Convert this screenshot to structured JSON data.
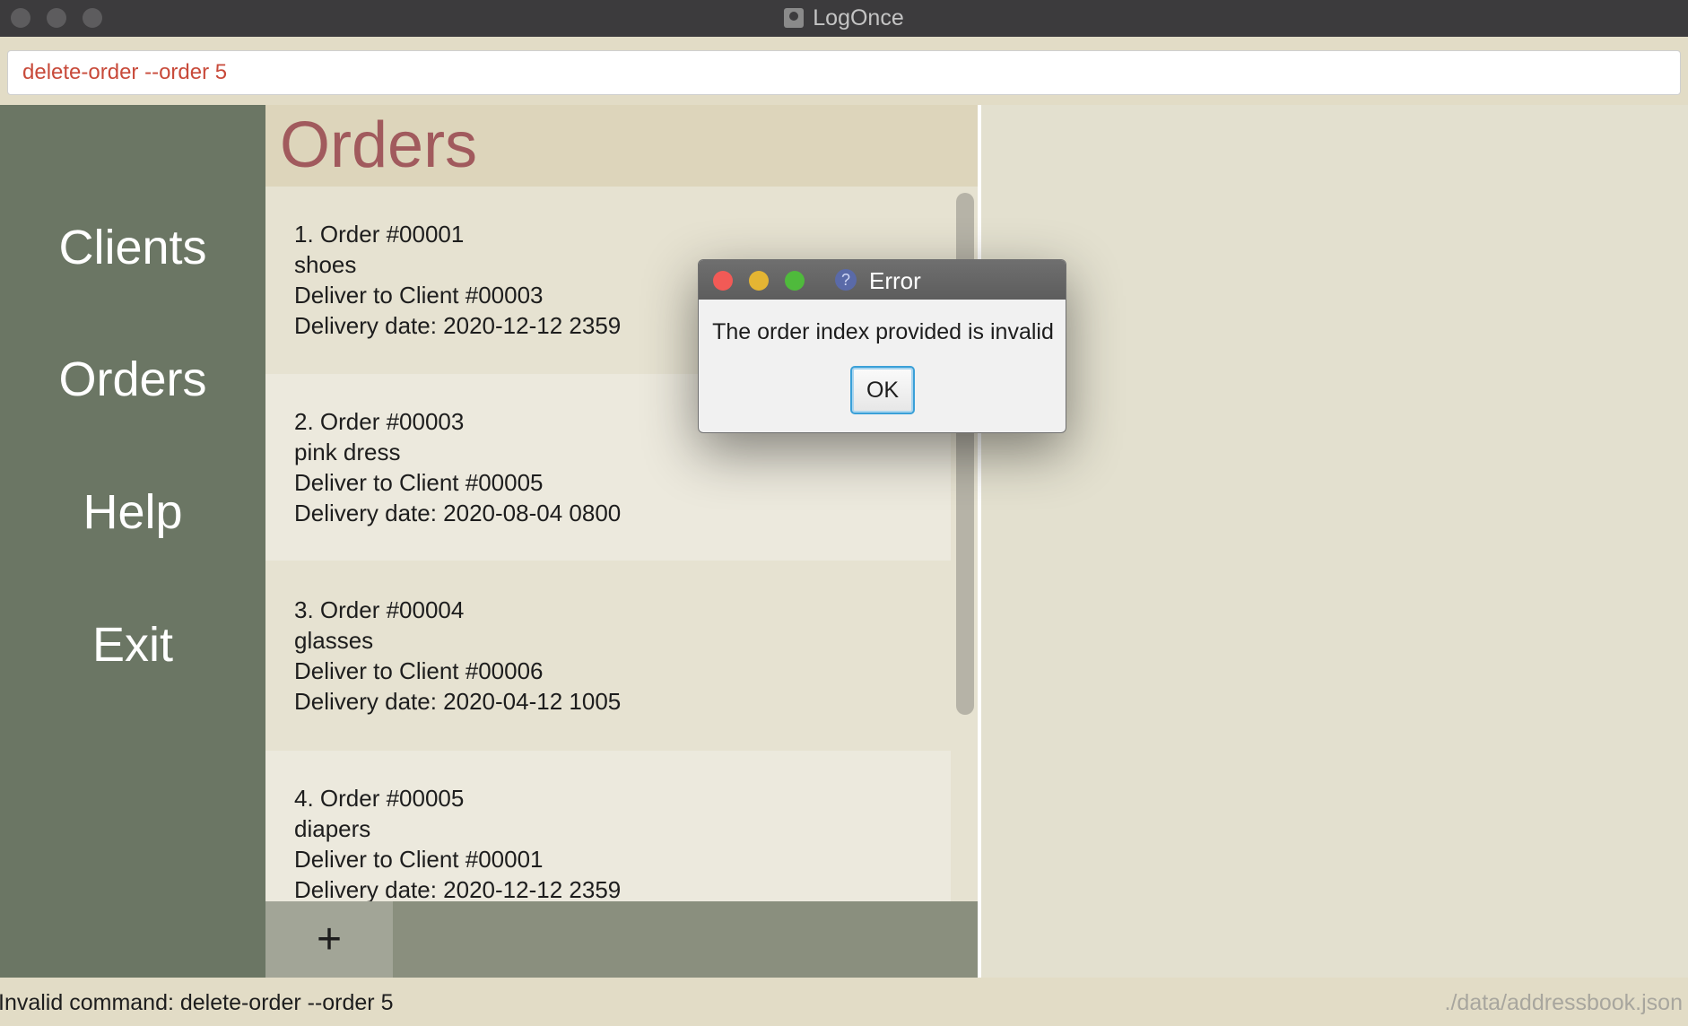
{
  "window": {
    "title": "LogOnce"
  },
  "command": {
    "value": "delete-order --order 5"
  },
  "sidebar": {
    "items": [
      "Clients",
      "Orders",
      "Help",
      "Exit"
    ]
  },
  "orders_panel": {
    "title": "Orders",
    "orders": [
      {
        "header": "1.  Order #00001",
        "item": "shoes",
        "client": "Deliver to Client #00003",
        "date": "Delivery date: 2020-12-12 2359"
      },
      {
        "header": "2.  Order #00003",
        "item": "pink dress",
        "client": "Deliver to Client #00005",
        "date": "Delivery date: 2020-08-04 0800"
      },
      {
        "header": "3.  Order #00004",
        "item": "glasses",
        "client": "Deliver to Client #00006",
        "date": "Delivery date: 2020-04-12 1005"
      },
      {
        "header": "4.  Order #00005",
        "item": "diapers",
        "client": "Deliver to Client #00001",
        "date": "Delivery date: 2020-12-12 2359"
      }
    ],
    "add_label": "+"
  },
  "status": {
    "message": "Invalid command: delete-order --order 5",
    "file": "./data/addressbook.json"
  },
  "dialog": {
    "title": "Error",
    "message": "The order index provided is invalid",
    "ok_label": "OK",
    "help_glyph": "?"
  }
}
